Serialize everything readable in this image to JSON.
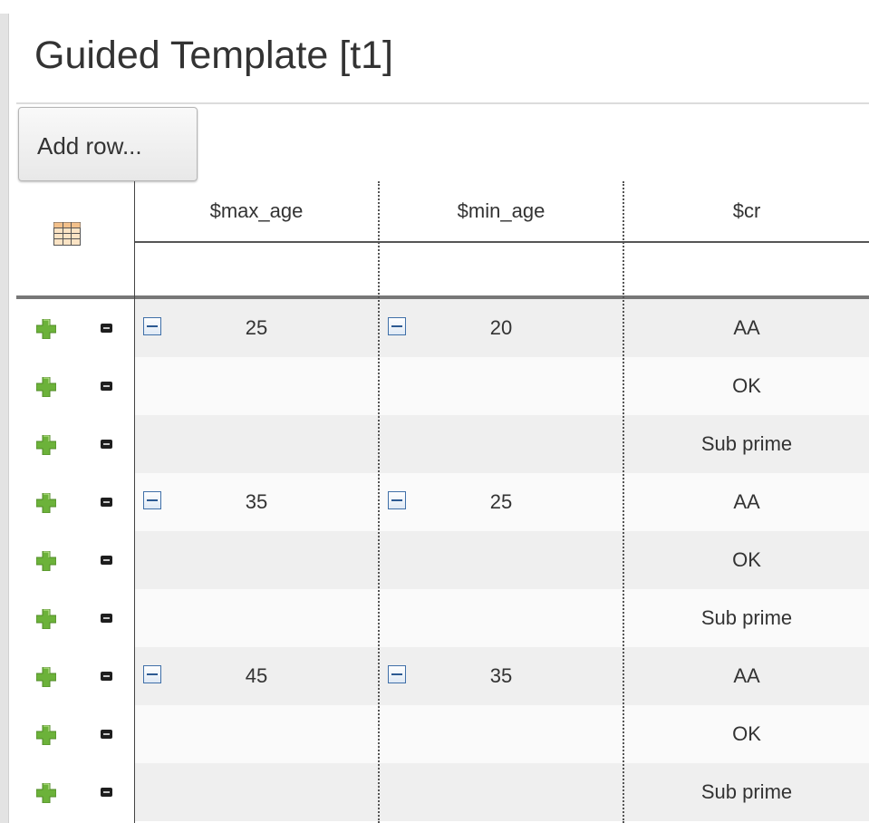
{
  "title": "Guided Template [t1]",
  "toolbar": {
    "add_row_label": "Add row..."
  },
  "columns": [
    {
      "header": "$max_age"
    },
    {
      "header": "$min_age"
    },
    {
      "header": "$cr"
    }
  ],
  "rows": [
    {
      "max_age": "25",
      "min_age": "20",
      "cr": "AA"
    },
    {
      "max_age": "",
      "min_age": "",
      "cr": "OK"
    },
    {
      "max_age": "",
      "min_age": "",
      "cr": "Sub prime"
    },
    {
      "max_age": "35",
      "min_age": "25",
      "cr": "AA"
    },
    {
      "max_age": "",
      "min_age": "",
      "cr": "OK"
    },
    {
      "max_age": "",
      "min_age": "",
      "cr": "Sub prime"
    },
    {
      "max_age": "45",
      "min_age": "35",
      "cr": "AA"
    },
    {
      "max_age": "",
      "min_age": "",
      "cr": "OK"
    },
    {
      "max_age": "",
      "min_age": "",
      "cr": "Sub prime"
    }
  ],
  "colors": {
    "band_dark": "#efefef",
    "band_light": "#fafafa",
    "add_icon": "#6cb23a",
    "collapse_icon": "#2c5a92"
  }
}
